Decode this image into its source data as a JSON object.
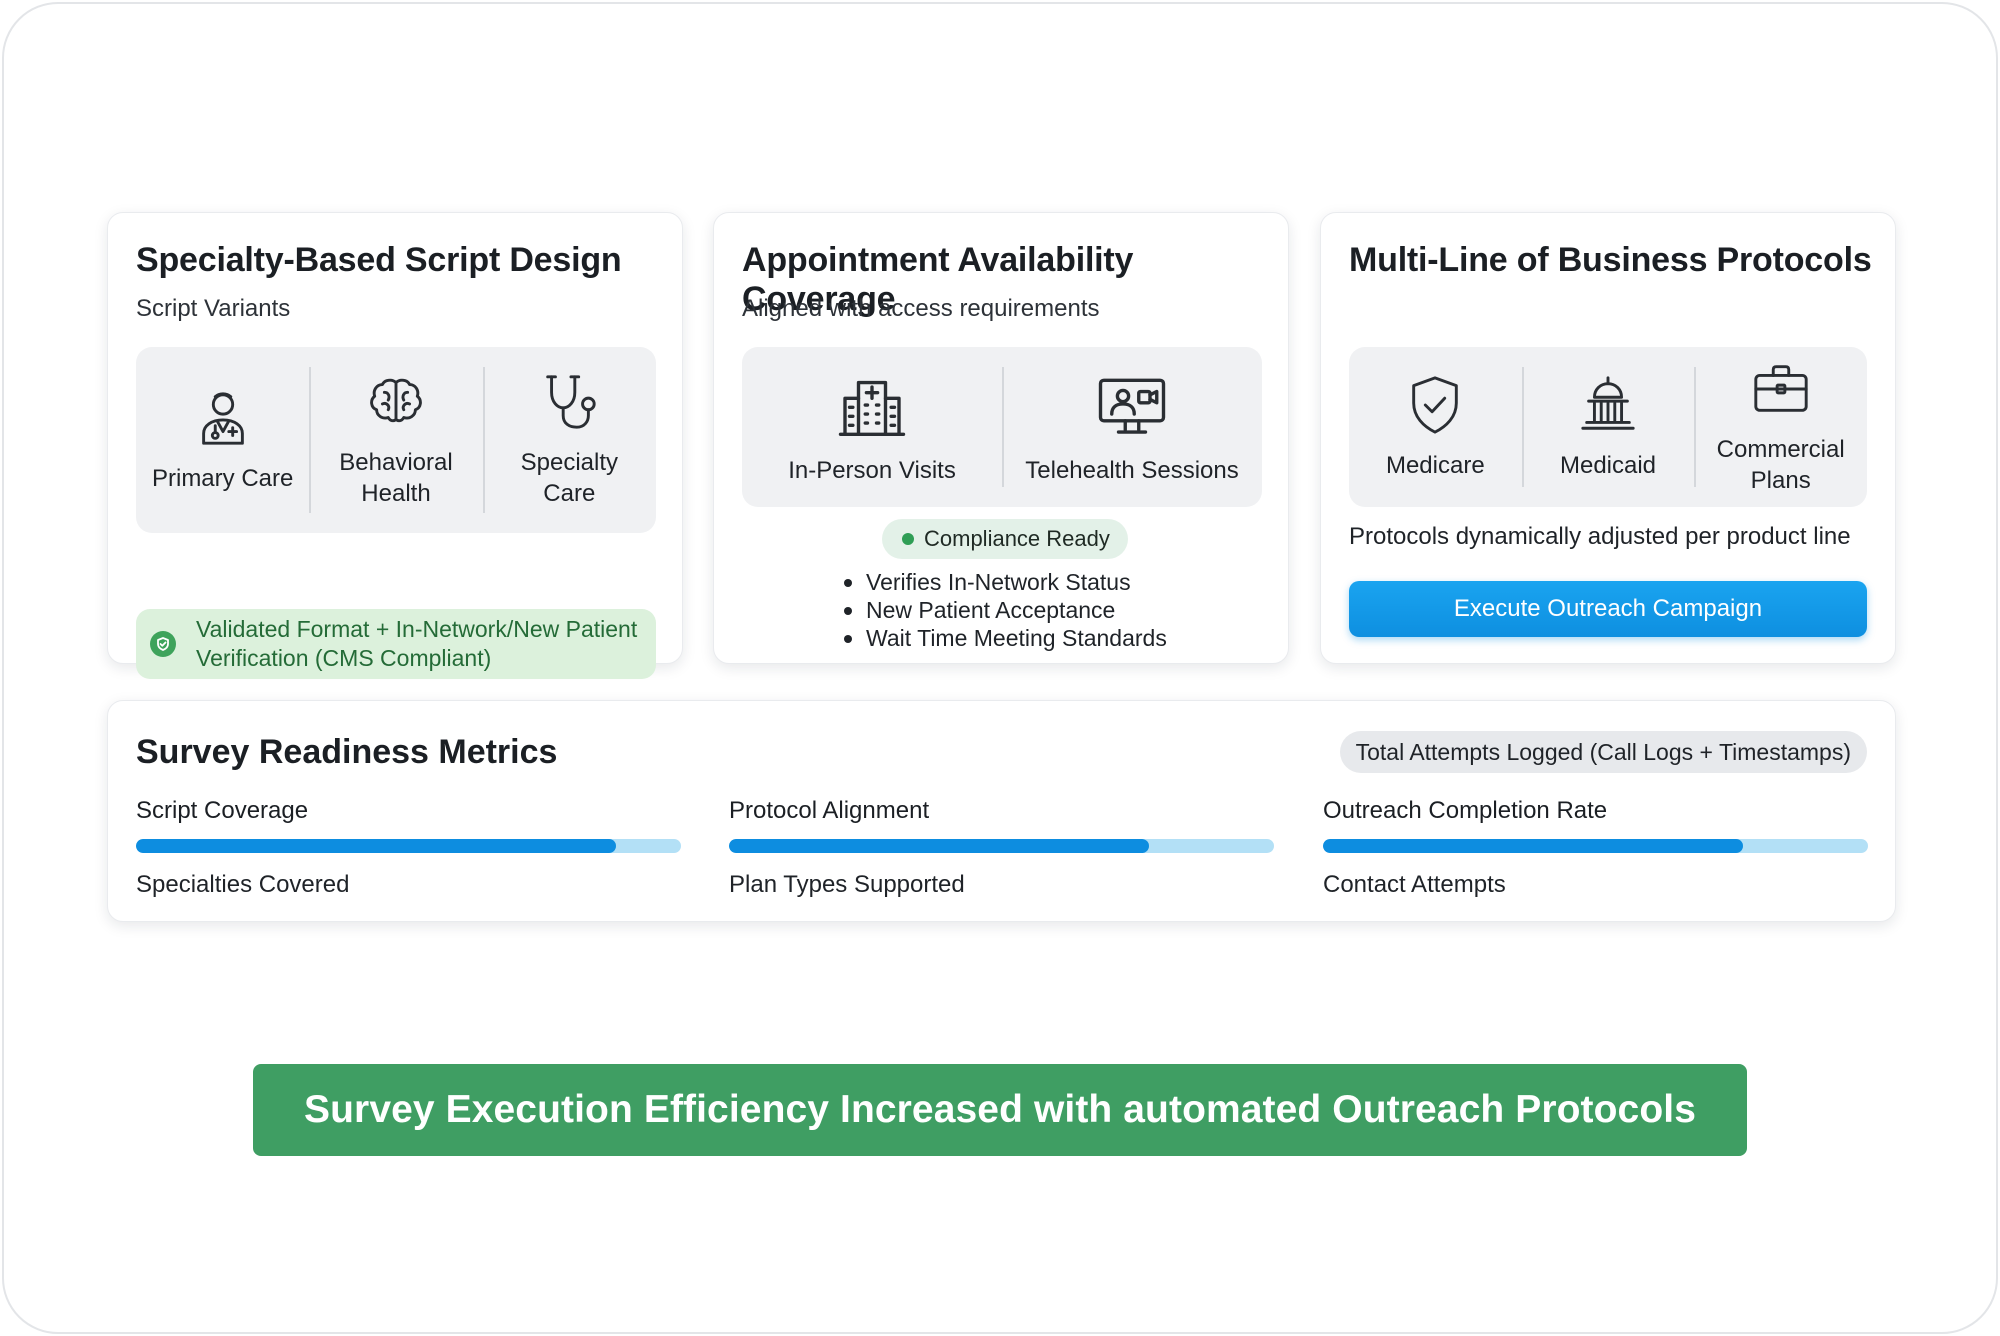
{
  "cards": {
    "script_design": {
      "title": "Specialty-Based Script Design",
      "subtitle": "Script Variants",
      "items": [
        {
          "label": "Primary Care",
          "icon": "doctor-icon"
        },
        {
          "label": "Behavioral\nHealth",
          "icon": "brain-icon"
        },
        {
          "label": "Specialty\nCare",
          "icon": "stethoscope-icon"
        }
      ],
      "validated_text": "Validated Format + In-Network/New Patient\nVerification (CMS Compliant)"
    },
    "availability": {
      "title": "Appointment Availability Coverage",
      "subtitle": "Aligned with access requirements",
      "items": [
        {
          "label": "In-Person Visits",
          "icon": "hospital-building-icon"
        },
        {
          "label": "Telehealth Sessions",
          "icon": "telehealth-monitor-icon"
        }
      ],
      "compliance_label": "Compliance Ready",
      "bullets": [
        "Verifies In-Network Status",
        "New Patient Acceptance",
        "Wait Time Meeting Standards"
      ]
    },
    "protocols": {
      "title": "Multi-Line of Business Protocols",
      "items": [
        {
          "label": "Medicare",
          "icon": "shield-check-icon"
        },
        {
          "label": "Medicaid",
          "icon": "capitol-building-icon"
        },
        {
          "label": "Commercial\nPlans",
          "icon": "briefcase-icon"
        }
      ],
      "note": "Protocols dynamically adjusted per product line",
      "cta_label": "Execute Outreach Campaign"
    }
  },
  "metrics": {
    "title": "Survey Readiness Metrics",
    "attempts_label": "Total Attempts Logged (Call Logs + Timestamps)",
    "items": [
      {
        "label": "Script Coverage",
        "sub": "Specialties Covered",
        "progress": 0.88
      },
      {
        "label": "Protocol Alignment",
        "sub": "Plan Types Supported",
        "progress": 0.77
      },
      {
        "label": "Outreach Completion Rate",
        "sub": "Contact Attempts",
        "progress": 0.77
      }
    ]
  },
  "banner": "Survey Execution Efficiency Increased with automated Outreach Protocols",
  "colors": {
    "accent_blue": "#0d8de0",
    "track_blue": "#b3e0f6",
    "banner_green": "#3f9e63",
    "validated_bg": "#dcf1dc"
  }
}
